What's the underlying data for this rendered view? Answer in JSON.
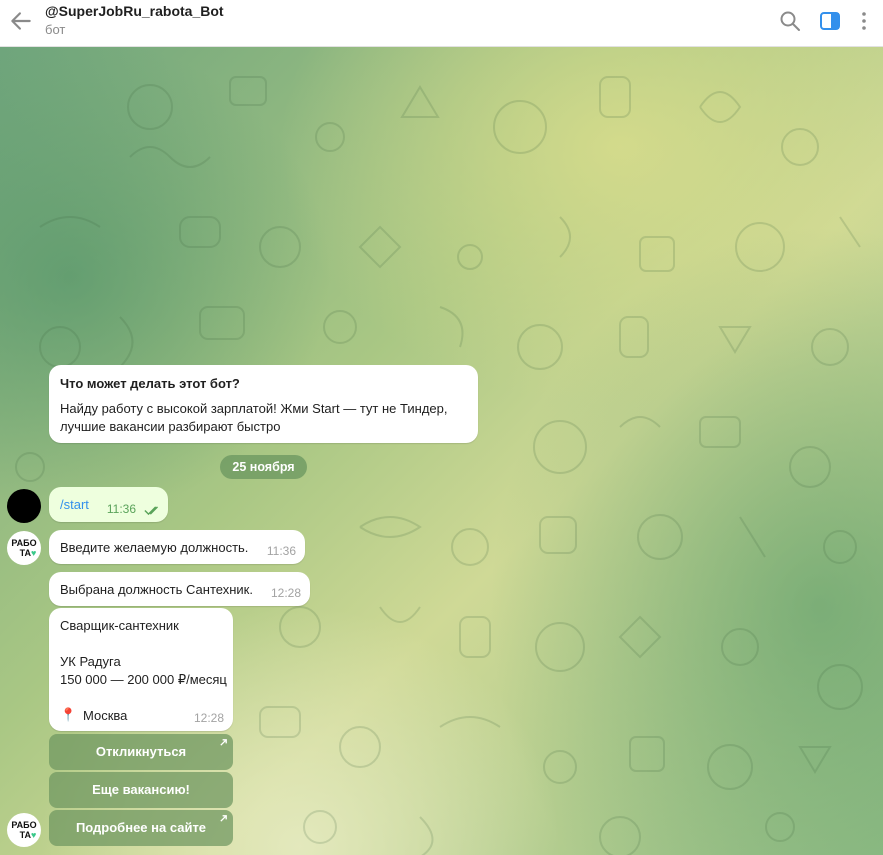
{
  "header": {
    "title": "@SuperJobRu_rabota_Bot",
    "subtitle": "бот"
  },
  "intro": {
    "heading": "Что может делать этот бот?",
    "line1": "Найду работу с высокой зарплатой! Жми Start — тут не Тиндер,",
    "line2": "лучшие вакансии разбирают быстро"
  },
  "date_label": "25 ноября",
  "messages": [
    {
      "sender": "user",
      "text": "/start",
      "time": "11:36"
    },
    {
      "sender": "bot",
      "text": "Введите желаемую должность.",
      "time": "11:36"
    },
    {
      "sender": "bot",
      "text": "Выбрана должность Сантехник.",
      "time": "12:28"
    }
  ],
  "vacancy": {
    "title": "Сварщик-сантехник",
    "company": "УК Радуга",
    "salary": "150 000 — 200 000 ₽/месяц",
    "location_icon": "📍",
    "location": "Москва",
    "time": "12:28"
  },
  "buttons": [
    "Откликнуться",
    "Еще вакансию!",
    "Подробнее на сайте"
  ],
  "bot_avatar": {
    "line1": "РАБО",
    "line2": "ТА",
    "heart": "♥"
  },
  "colors": {
    "accent": "#3390ec",
    "outgoing_bubble": "#eeffde",
    "check_marks": "#5aa35a"
  }
}
